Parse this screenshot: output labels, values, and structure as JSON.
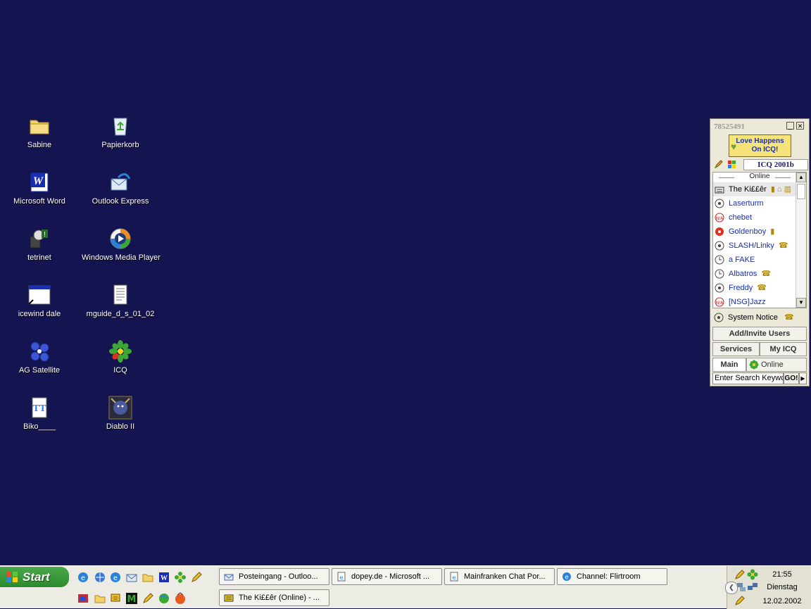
{
  "desktop": {
    "icons": [
      {
        "label": "Sabine",
        "icon": "folder-icon"
      },
      {
        "label": "Papierkorb",
        "icon": "recycle-bin-icon"
      },
      {
        "label": "Microsoft Word",
        "icon": "word-icon"
      },
      {
        "label": "Outlook Express",
        "icon": "outlook-express-icon"
      },
      {
        "label": "tetrinet",
        "icon": "tetrinet-icon"
      },
      {
        "label": "Windows Media Player",
        "icon": "media-player-icon"
      },
      {
        "label": "icewind dale",
        "icon": "window-app-icon"
      },
      {
        "label": "mguide_d_s_01_02",
        "icon": "text-document-icon"
      },
      {
        "label": "AG Satellite",
        "icon": "satellite-icon"
      },
      {
        "label": "ICQ",
        "icon": "icq-flower-icon"
      },
      {
        "label": "Biko____",
        "icon": "font-file-icon"
      },
      {
        "label": "Diablo II",
        "icon": "diablo-icon"
      }
    ]
  },
  "icq": {
    "uin": "78525491",
    "banner_line1": "Love Happens",
    "banner_line2": "On ICQ!",
    "version": "ICQ 2001b",
    "group_label": "Online",
    "contacts": [
      {
        "name": "The Ki££êr",
        "extra": "▮ ⌂ ▥"
      },
      {
        "name": "Laserturm",
        "extra": ""
      },
      {
        "name": "chebet",
        "extra": ""
      },
      {
        "name": "Goldenboy",
        "extra": "▮"
      },
      {
        "name": "SLASH/Linky",
        "extra": "☎"
      },
      {
        "name": "a FAKE",
        "extra": ""
      },
      {
        "name": "Albatros",
        "extra": "☎"
      },
      {
        "name": "Freddy",
        "extra": "☎"
      },
      {
        "name": "[NSG]Jazz",
        "extra": ""
      }
    ],
    "system_notice": "System Notice",
    "add_invite": "Add/Invite Users",
    "services": "Services",
    "my_icq": "My ICQ",
    "main": "Main",
    "status": "Online",
    "search_placeholder": "Enter Search Keywc",
    "go": "GO!"
  },
  "taskbar": {
    "start_label": "Start",
    "tasks_row1": [
      {
        "label": "Posteingang - Outloo..."
      },
      {
        "label": "dopey.de - Microsoft ..."
      },
      {
        "label": "Mainfranken Chat Por..."
      },
      {
        "label": "Channel: Flirtroom"
      }
    ],
    "tasks_row2": [
      {
        "label": "The Ki££êr (Online) - ..."
      }
    ],
    "clock_time": "21:55",
    "clock_day": "Dienstag",
    "clock_date": "12.02.2002"
  },
  "colors": {
    "desktop_bg": "#141450",
    "start_green": "#3a9a3a",
    "icq_green": "#3aa832",
    "link_blue": "#1a2fb0"
  }
}
